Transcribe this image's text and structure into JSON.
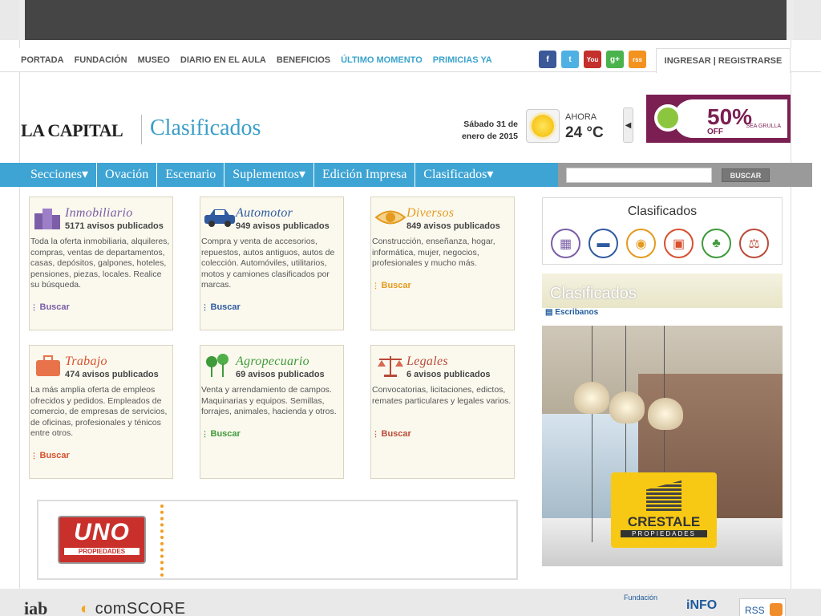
{
  "topnav": {
    "links": [
      "PORTADA",
      "FUNDACIÓN",
      "MUSEO",
      "DIARIO EN EL AULA",
      "BENEFICIOS"
    ],
    "highlight_links": [
      "ÚLTIMO MOMENTO",
      "PRIMICIAS YA"
    ],
    "login": "INGRESAR | REGISTRARSE",
    "social": [
      "f",
      "t",
      "You",
      "g+",
      "rss"
    ]
  },
  "header": {
    "logo": "LA CAPITAL",
    "section_title": "Clasificados",
    "date_line1": "Sábado 31 de",
    "date_line2": "enero de 2015",
    "weather_label": "AHORA",
    "temperature": "24 °C",
    "ad_percent": "50%",
    "ad_off": "OFF",
    "ad_brand": "SEA GRULLA"
  },
  "mainnav": [
    "Secciones▾",
    "Ovación",
    "Escenario",
    "Suplementos▾",
    "Edición Impresa",
    "Clasificados▾"
  ],
  "search": {
    "button": "BUSCAR",
    "placeholder": ""
  },
  "cards": [
    {
      "title": "Inmobiliario",
      "count": "5171 avisos publicados",
      "desc": "Toda la oferta inmobiliaria, alquileres, compras, ventas de departamentos, casas, depósitos, galpones, hoteles, pensiones, piezas, locales. Realice su búsqueda.",
      "buscar": "Buscar",
      "color": "#7b5ea7"
    },
    {
      "title": "Automotor",
      "count": "949 avisos publicados",
      "desc": "Compra y venta de accesorios, repuestos, autos antiguos, autos de colección. Automóviles, utilitarios, motos y camiones clasificados por marcas.",
      "buscar": "Buscar",
      "color": "#2f5aa0"
    },
    {
      "title": "Diversos",
      "count": "849 avisos publicados",
      "desc": "Construcción, enseñanza, hogar, informática, mujer, negocios, profesionales y mucho más.",
      "buscar": "Buscar",
      "color": "#e49a1f"
    },
    {
      "title": "Trabajo",
      "count": "474 avisos publicados",
      "desc": "La más amplia oferta de empleos ofrecidos y pedidos. Empleados de comercio, de empresas de servicios, de oficinas, profesionales y ténicos entre otros.",
      "buscar": "Buscar",
      "color": "#d7502e"
    },
    {
      "title": "Agropecuario",
      "count": "69 avisos publicados",
      "desc": "Venta y arrendamiento de campos. Maquinarias y equipos. Semillas, forrajes, animales, hacienda y otros.",
      "buscar": "Buscar",
      "color": "#3f9a3a"
    },
    {
      "title": "Legales",
      "count": "6 avisos publicados",
      "desc": "Convocatorias, licitaciones, edictos, remates particulares y legales varios.",
      "buscar": "Buscar",
      "color": "#c0503a"
    }
  ],
  "bottom_ad": {
    "brand": "UNO",
    "sub": "PROPIEDADES"
  },
  "right": {
    "box_title": "Clasificados",
    "banner_title": "Clasificados",
    "escribanos": "Escribanos",
    "crestale_brand": "CRESTALE",
    "crestale_sub": "PROPIEDADES"
  },
  "footer": {
    "iab": "iab",
    "comscore": "comSCORE",
    "fundacion": "Fundación",
    "info": "iNFO",
    "rss": "RSS"
  }
}
